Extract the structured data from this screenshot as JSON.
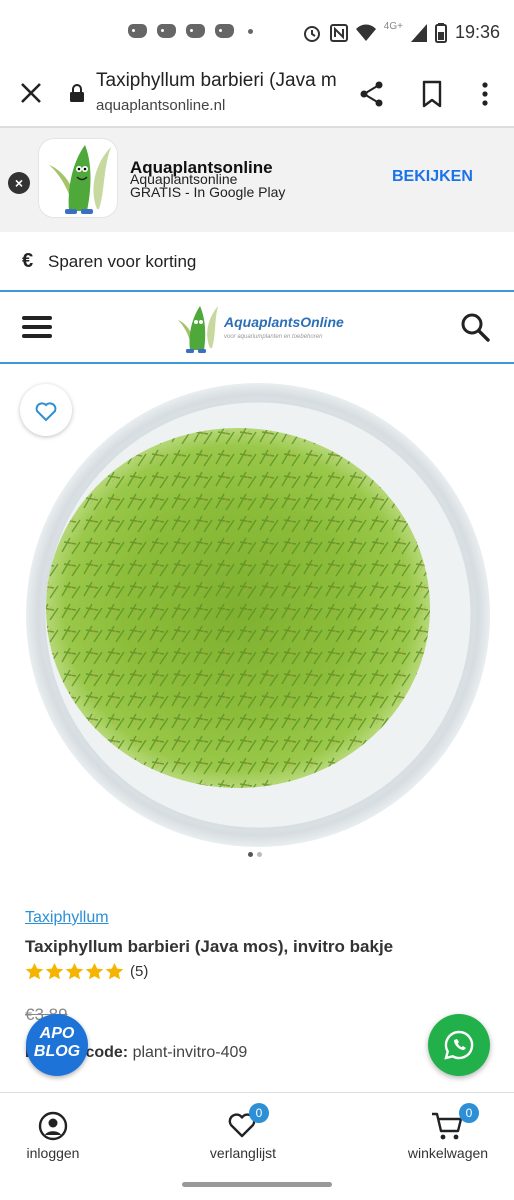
{
  "status_bar": {
    "time": "19:36",
    "network": "4G+"
  },
  "browser": {
    "page_title": "Taxiphyllum barbieri (Java mos), invitro bakje",
    "url": "aquaplantsonline.nl"
  },
  "app_banner": {
    "name": "Aquaplantsonline",
    "publisher": "Aquaplantsonline",
    "subtitle": "GRATIS - In Google Play",
    "cta": "BEKIJKEN"
  },
  "promo": {
    "symbol": "€",
    "text": "Sparen voor korting"
  },
  "site_logo": {
    "name": "AquaplantsOnline",
    "tagline": "voor aquariumplanten en toebehoren"
  },
  "product": {
    "category": "Taxiphyllum",
    "title": "Taxiphyllum barbieri (Java mos), invitro bakje",
    "rating": 5,
    "review_count": "(5)",
    "price": "€3,89",
    "code_label": "Productcode:",
    "code_value": "plant-invitro-409",
    "image_index": 1,
    "image_count": 2
  },
  "floating": {
    "apo_line1": "APO",
    "apo_line2": "BLOG"
  },
  "bottom_nav": {
    "items": [
      {
        "label": "inloggen",
        "icon": "user-icon"
      },
      {
        "label": "verlanglijst",
        "icon": "heart-icon",
        "badge": "0"
      },
      {
        "label": "winkelwagen",
        "icon": "cart-icon",
        "badge": "0"
      }
    ]
  },
  "colors": {
    "accent": "#2d8fd5",
    "whatsapp": "#22b04a",
    "cta": "#1a73e8",
    "star": "#f5b400"
  }
}
